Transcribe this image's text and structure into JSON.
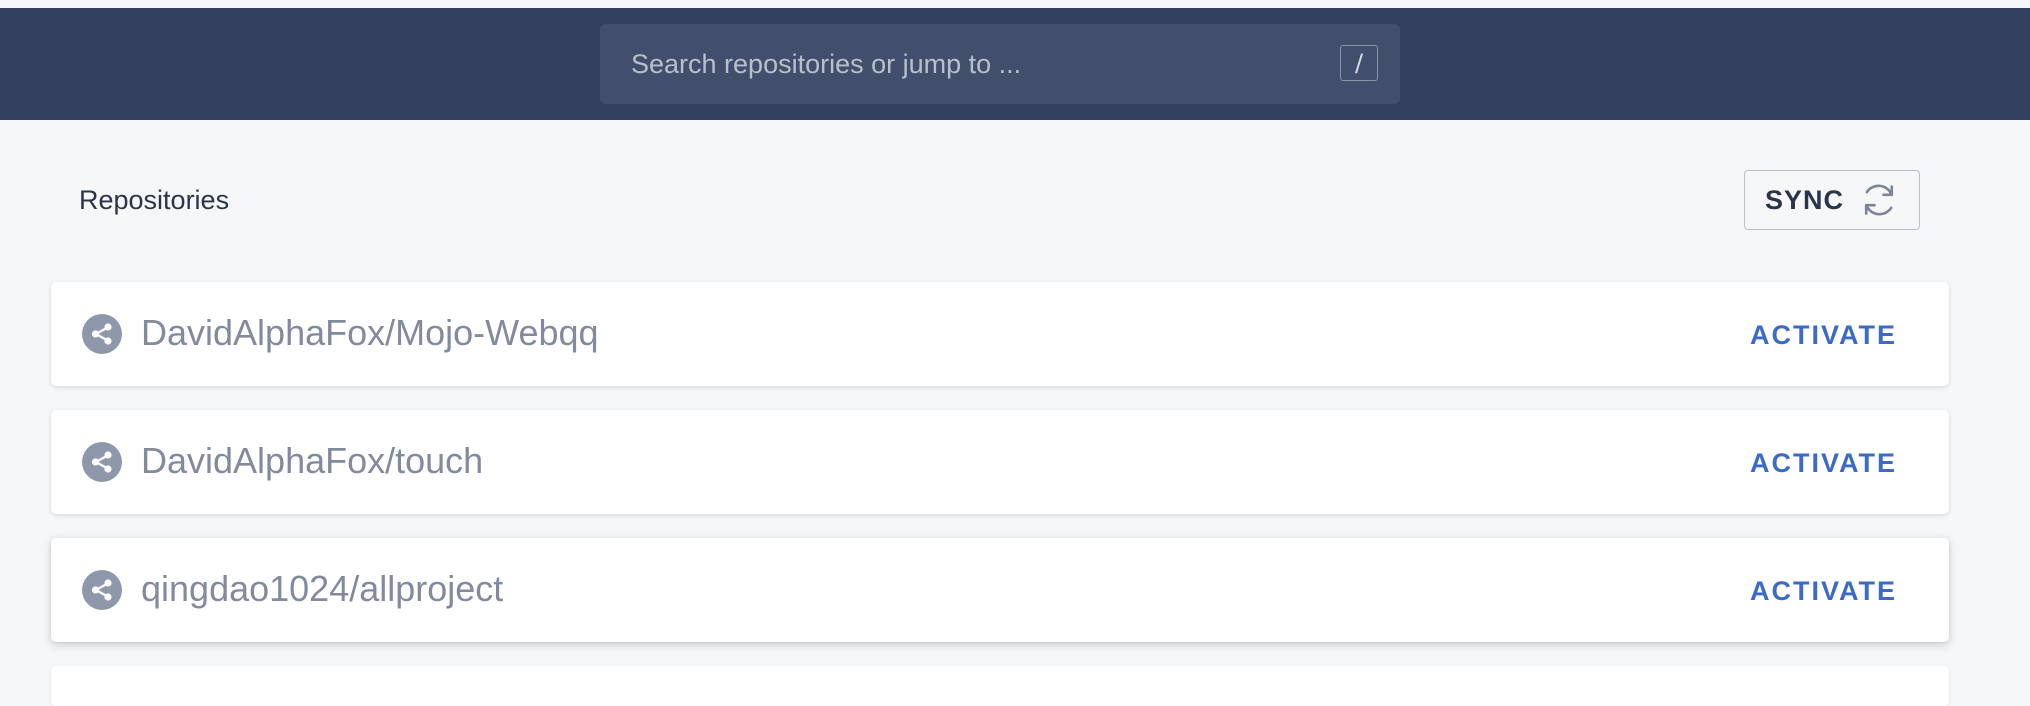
{
  "search": {
    "placeholder": "Search repositories or jump to ...",
    "shortcut": "/"
  },
  "page": {
    "title": "Repositories"
  },
  "sync": {
    "label": "SYNC",
    "icon": "sync-icon"
  },
  "repos": [
    {
      "name": "DavidAlphaFox/Mojo-Webqq",
      "action": "ACTIVATE",
      "icon": "share-icon"
    },
    {
      "name": "DavidAlphaFox/touch",
      "action": "ACTIVATE",
      "icon": "share-icon"
    },
    {
      "name": "qingdao1024/allproject",
      "action": "ACTIVATE",
      "icon": "share-icon"
    }
  ],
  "colors": {
    "header": "#33405e",
    "search_bg": "#424f6c",
    "accent": "#3c6ac9",
    "background": "#f6f7f9"
  }
}
